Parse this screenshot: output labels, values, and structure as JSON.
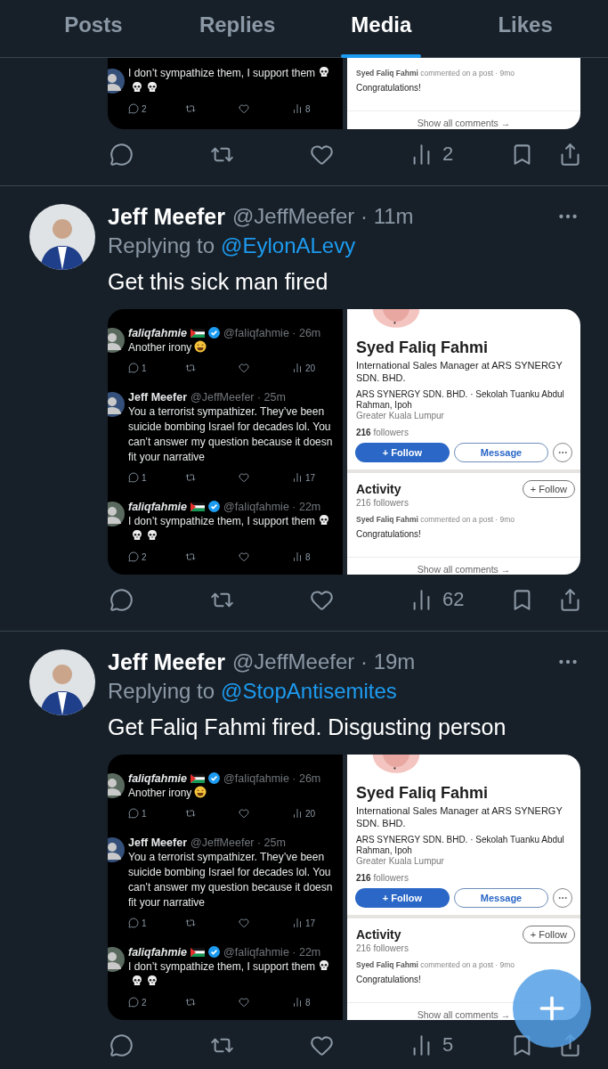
{
  "tabs": [
    {
      "label": "Posts",
      "selected": false
    },
    {
      "label": "Replies",
      "selected": false
    },
    {
      "label": "Media",
      "selected": true
    },
    {
      "label": "Likes",
      "selected": false
    }
  ],
  "posts": [
    {
      "media": {
        "tweets": [
          {
            "text": "I don’t sympathize them, I support them",
            "emoji": [
              {
                "kind": "skull"
              },
              {
                "kind": "skull"
              },
              {
                "kind": "skull"
              }
            ],
            "replies": "2",
            "views": "8"
          }
        ],
        "profile": {
          "activity": {
            "comment": "**Syed Faliq Fahmi** commented on a post · 9mo",
            "comment_text": "Congratulations!",
            "footer": "Show all comments →"
          }
        }
      },
      "views": "2"
    },
    {
      "author": "Jeff Meefer",
      "handle": "@JeffMeefer · 11m",
      "replying_prefix": "Replying to",
      "replying_to": "@EylonALevy",
      "text": "Get this sick man fired",
      "media": {
        "tweets": [
          {
            "name": "faliqfahmie",
            "italic": true,
            "flag": true,
            "verified": true,
            "handle": "@faIiqfahmie · 26m",
            "text": "Another irony",
            "emoji": [
              {
                "kind": "laugh"
              }
            ],
            "replies": "1",
            "views": "20"
          },
          {
            "name": "Jeff Meefer",
            "italic": false,
            "flag": false,
            "verified": false,
            "handle": "@JeffMeefer · 25m",
            "text": "You a terrorist sympathizer. They’ve been suicide bombing Israel for decades lol. You can’t answer my question because it doesn fit your narrative",
            "replies": "1",
            "views": "17"
          },
          {
            "name": "faliqfahmie",
            "italic": true,
            "flag": true,
            "verified": true,
            "handle": "@faIiqfahmie · 22m",
            "text": "I don’t sympathize them, I support them",
            "emoji": [
              {
                "kind": "skull"
              },
              {
                "kind": "skull"
              },
              {
                "kind": "skull"
              }
            ],
            "replies": "2",
            "views": "8"
          }
        ],
        "profile": {
          "name": "Syed Faliq Fahmi",
          "headline": "International Sales Manager at ARS SYNERGY SDN. BHD.",
          "details": "ARS SYNERGY SDN. BHD. · Sekolah Tuanku Abdul Rahman, Ipoh",
          "location": "Greater Kuala Lumpur",
          "followers": "**216** followers",
          "buttons": [
            {
              "label": "+ Follow",
              "kind": "primary"
            },
            {
              "label": "Message",
              "kind": "outline"
            },
            {
              "kind": "more"
            }
          ],
          "activity": {
            "title": "Activity",
            "followers": "216 followers",
            "follow": "+ Follow",
            "comment": "**Syed Faliq Fahmi** commented on a post · 9mo",
            "comment_text": "Congratulations!",
            "footer": "Show all comments →"
          }
        }
      },
      "views": "62"
    },
    {
      "author": "Jeff Meefer",
      "handle": "@JeffMeefer · 19m",
      "replying_prefix": "Replying to",
      "replying_to": "@StopAntisemites",
      "text": "Get Faliq Fahmi fired. Disgusting person",
      "media": {
        "tweets": [
          {
            "name": "faliqfahmie",
            "italic": true,
            "flag": true,
            "verified": true,
            "handle": "@faIiqfahmie · 26m",
            "text": "Another irony",
            "emoji": [
              {
                "kind": "laugh"
              }
            ],
            "replies": "1",
            "views": "20"
          },
          {
            "name": "Jeff Meefer",
            "italic": false,
            "flag": false,
            "verified": false,
            "handle": "@JeffMeefer · 25m",
            "text": "You a terrorist sympathizer. They’ve been suicide bombing Israel for decades lol. You can’t answer my question because it doesn fit your narrative",
            "replies": "1",
            "views": "17"
          },
          {
            "name": "faliqfahmie",
            "italic": true,
            "flag": true,
            "verified": true,
            "handle": "@faIiqfahmie · 22m",
            "text": "I don’t sympathize them, I support them",
            "emoji": [
              {
                "kind": "skull"
              },
              {
                "kind": "skull"
              },
              {
                "kind": "skull"
              }
            ],
            "replies": "2",
            "views": "8"
          }
        ],
        "profile": {
          "name": "Syed Faliq Fahmi",
          "headline": "International Sales Manager at ARS SYNERGY SDN. BHD.",
          "details": "ARS SYNERGY SDN. BHD. · Sekolah Tuanku Abdul Rahman, Ipoh",
          "location": "Greater Kuala Lumpur",
          "followers": "**216** followers",
          "buttons": [
            {
              "label": "+ Follow",
              "kind": "primary"
            },
            {
              "label": "Message",
              "kind": "outline"
            },
            {
              "kind": "more"
            }
          ],
          "activity": {
            "title": "Activity",
            "followers": "216 followers",
            "follow": "+ Follow",
            "comment": "**Syed Faliq Fahmi** commented on a post · 9mo",
            "comment_text": "Congratulations!",
            "footer": "Show all comments →"
          }
        }
      },
      "views": "5"
    }
  ]
}
